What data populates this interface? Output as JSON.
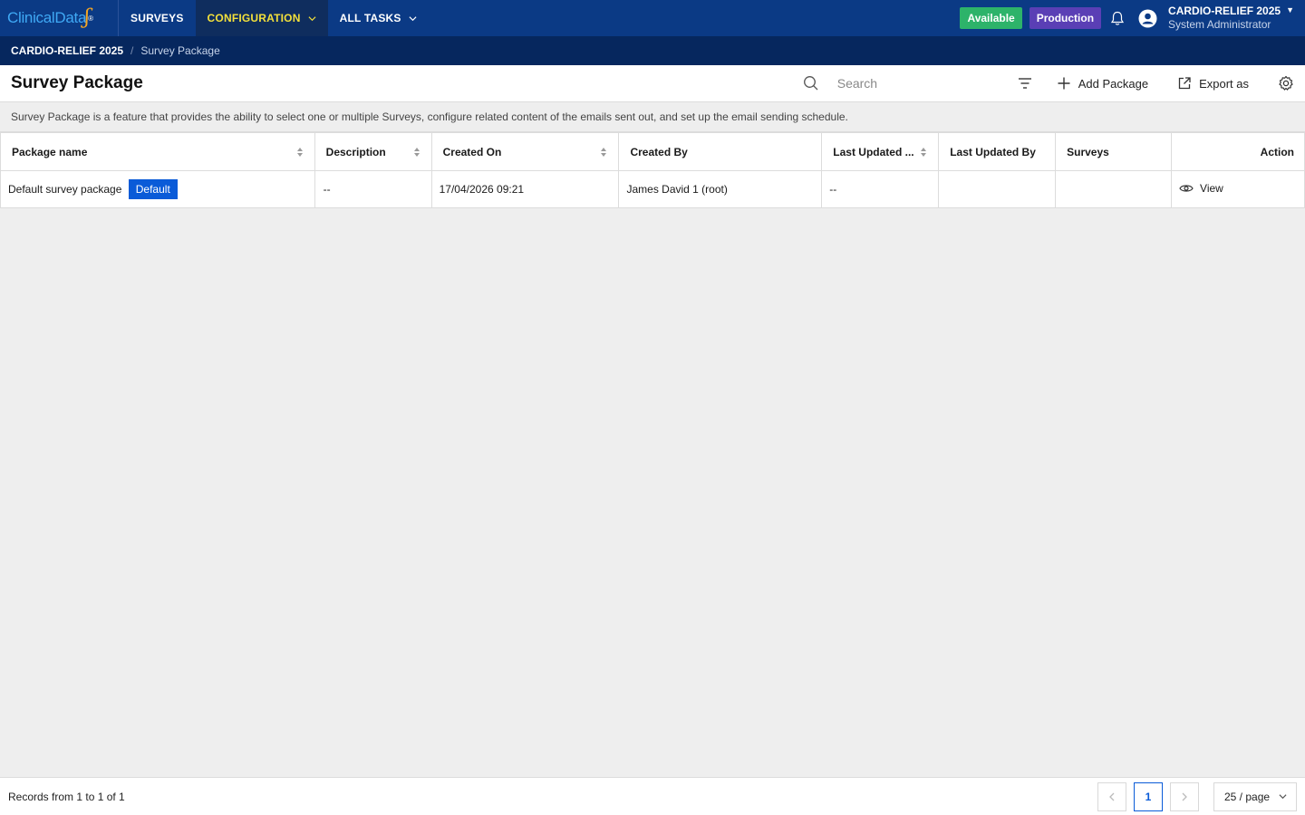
{
  "nav": {
    "logo_text": "ClinicalData",
    "items": [
      {
        "label": "SURVEYS"
      },
      {
        "label": "CONFIGURATION"
      },
      {
        "label": "ALL TASKS"
      }
    ],
    "status_badge": "Available",
    "env_badge": "Production",
    "user_study": "CARDIO-RELIEF 2025",
    "user_role": "System Administrator"
  },
  "breadcrumb": {
    "root": "CARDIO-RELIEF 2025",
    "separator": "/",
    "current": "Survey Package"
  },
  "header": {
    "title": "Survey Package",
    "search_placeholder": "Search",
    "add_label": "Add Package",
    "export_label": "Export as"
  },
  "description": "Survey Package is a feature that provides the ability to select one or multiple Surveys, configure related content of the emails sent out, and set up the email sending schedule.",
  "table": {
    "columns": [
      "Package name",
      "Description",
      "Created On",
      "Created By",
      "Last Updated ...",
      "Last Updated By",
      "Surveys",
      "Action"
    ],
    "rows": [
      {
        "package_name": "Default survey package",
        "badge": "Default",
        "description": "--",
        "created_on": "17/04/2026 09:21",
        "created_by": "James David 1 (root)",
        "last_updated": "--",
        "last_updated_by": "",
        "surveys": "",
        "action": "View"
      }
    ]
  },
  "footer": {
    "records": "Records from 1 to 1 of 1",
    "current_page": "1",
    "page_size": "25 / page"
  },
  "colors": {
    "nav_bg": "#0b3a85",
    "breadcrumb_bg": "#06275e",
    "active_nav_text": "#f3e03b",
    "available": "#2db36a",
    "production": "#5a3fb5",
    "primary": "#0a5bd8"
  }
}
